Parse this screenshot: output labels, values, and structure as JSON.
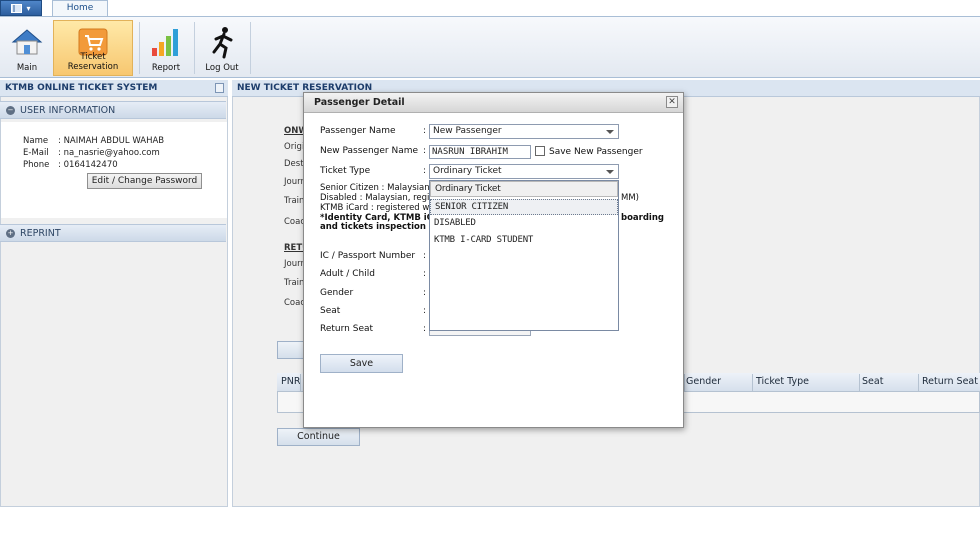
{
  "ribbon": {
    "app_menu_icon": "window-menu-icon",
    "tab_home": "Home",
    "buttons": [
      {
        "label": "Main",
        "icon": "house-icon"
      },
      {
        "label": "Ticket Reservation",
        "icon": "shopping-cart-icon"
      },
      {
        "label": "Report",
        "icon": "bar-chart-icon"
      },
      {
        "label": "Log Out",
        "icon": "running-man-icon"
      }
    ]
  },
  "sidebar": {
    "system_title": "KTMB ONLINE TICKET SYSTEM",
    "user_info_header": "USER INFORMATION",
    "name_label": "Name",
    "name_value": ": NAIMAH ABDUL WAHAB",
    "email_label": "E-Mail",
    "email_value": ": na_nasrie@yahoo.com",
    "phone_label": "Phone",
    "phone_value": ": 0164142470",
    "edit_button": "Edit / Change Password",
    "reprint_header": "REPRINT"
  },
  "main": {
    "title": "NEW TICKET RESERVATION",
    "onward": "ONW",
    "origin": "Origi",
    "destination": "Desti",
    "journey": "Journ",
    "train": "Train",
    "coach": "Coac",
    "return": "RETU",
    "r_journey": "Journ",
    "r_train": "Train",
    "r_coach": "Coac",
    "grid_columns": [
      "PNR",
      "Gender",
      "Ticket Type",
      "Seat",
      "Return Seat"
    ],
    "continue_button": "Continue"
  },
  "dialog": {
    "title": "Passenger Detail",
    "close": "✕",
    "passenger_name_label": "Passenger Name",
    "passenger_name_value": "New Passenger",
    "new_passenger_name_label": "New Passenger Name",
    "new_passenger_name_value": "NASRUN IBRAHIM",
    "save_new_passenger_label": "Save New Passenger",
    "ticket_type_label": "Ticket Type",
    "ticket_type_value": "Ordinary Ticket",
    "note_senior": "Senior Citizen : Malaysian, ag",
    "note_disabled": "Disabled : Malaysian, register",
    "note_disabled_tail": "MM)",
    "note_ktmb": "KTMB iCard : registered with",
    "note_identity": "*Identity Card, KTMB iCard",
    "note_identity_tail": "boarding",
    "note_inspection": "and tickets inspection at all",
    "ic_label": "IC / Passport Number",
    "adult_child_label": "Adult / Child",
    "gender_label": "Gender",
    "seat_label": "Seat",
    "return_seat_label": "Return Seat",
    "save_button": "Save",
    "colon": ":"
  },
  "ticket_type_options": [
    "Ordinary Ticket",
    "SENIOR CITIZEN",
    "DISABLED",
    "KTMB I-CARD STUDENT"
  ]
}
